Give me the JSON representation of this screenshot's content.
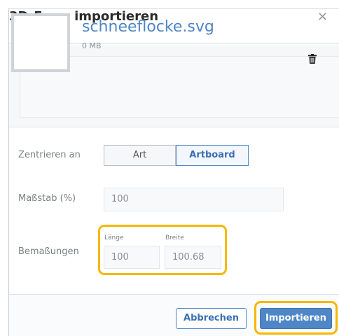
{
  "dialog": {
    "title": "3D-Form importieren",
    "close_symbol": "×"
  },
  "file": {
    "name": "schneeflocke.svg",
    "size": "0 MB",
    "thumbnail_icon": "blank-thumbnail",
    "delete_icon": "trash-icon"
  },
  "center_on": {
    "label": "Zentrieren an",
    "options": [
      "Art",
      "Artboard"
    ],
    "selected": "Artboard"
  },
  "scale": {
    "label": "Maßstab (%)",
    "value": "100"
  },
  "dimensions": {
    "label": "Bemaßungen",
    "length_label": "Länge",
    "length_value": "100",
    "width_label": "Breite",
    "width_value": "100.68"
  },
  "footer": {
    "cancel_label": "Abbrechen",
    "import_label": "Importieren"
  },
  "colors": {
    "accent": "#4f86c6",
    "highlight": "#f5b800"
  }
}
